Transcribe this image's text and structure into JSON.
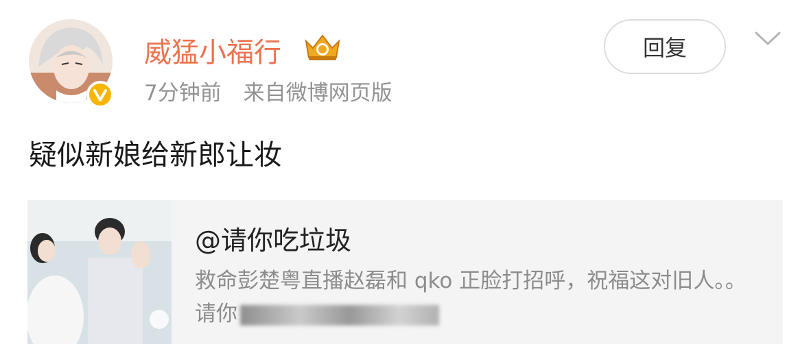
{
  "post": {
    "username": "威猛小福行",
    "time": "7分钟前",
    "source": "来自微博网页版",
    "reply_label": "回复",
    "text": "疑似新娘给新郎让妆"
  },
  "card": {
    "title": "@请你吃垃圾",
    "desc_visible": "救命彭楚粤直播赵磊和 qko 正脸打招呼，祝福这对旧人。。 请你"
  },
  "colors": {
    "username": "#eb7350",
    "meta": "#939393",
    "badge": "#f7b500"
  },
  "icons": [
    "verified-badge-icon",
    "crown-level-icon",
    "chevron-down-icon"
  ]
}
